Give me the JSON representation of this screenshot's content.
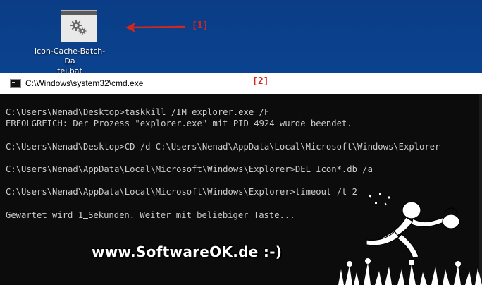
{
  "desktop": {
    "icon_label": "Icon-Cache-Batch-Datei.bat",
    "icon_label_line1": "Icon-Cache-Batch-Da",
    "icon_label_line2": "tei.bat",
    "icon": "batch-file-gears-icon"
  },
  "annotations": {
    "marker1": "[1]",
    "marker2": "[2]",
    "arrow_color": "#d3261f"
  },
  "cmd_window": {
    "title": "C:\\Windows\\system32\\cmd.exe",
    "lines": [
      "C:\\Users\\Nenad\\Desktop>taskkill /IM explorer.exe /F",
      "ERFOLGREICH: Der Prozess \"explorer.exe\" mit PID 4924 wurde beendet.",
      "",
      "C:\\Users\\Nenad\\Desktop>CD /d C:\\Users\\Nenad\\AppData\\Local\\Microsoft\\Windows\\Explorer",
      "",
      "C:\\Users\\Nenad\\AppData\\Local\\Microsoft\\Windows\\Explorer>DEL Icon*.db /a",
      "",
      "C:\\Users\\Nenad\\AppData\\Local\\Microsoft\\Windows\\Explorer>timeout /t 2",
      ""
    ],
    "wait_prefix": "Gewartet wird 1",
    "wait_suffix": "Sekunden. Weiter mit beliebiger Taste..."
  },
  "watermark": {
    "text": "www.SoftwareOK.de :-)"
  },
  "colors": {
    "desktop_bg": "#0b3f86",
    "console_bg": "#0c0c0c",
    "console_text": "#cccccc",
    "annotation": "#d3261f"
  }
}
